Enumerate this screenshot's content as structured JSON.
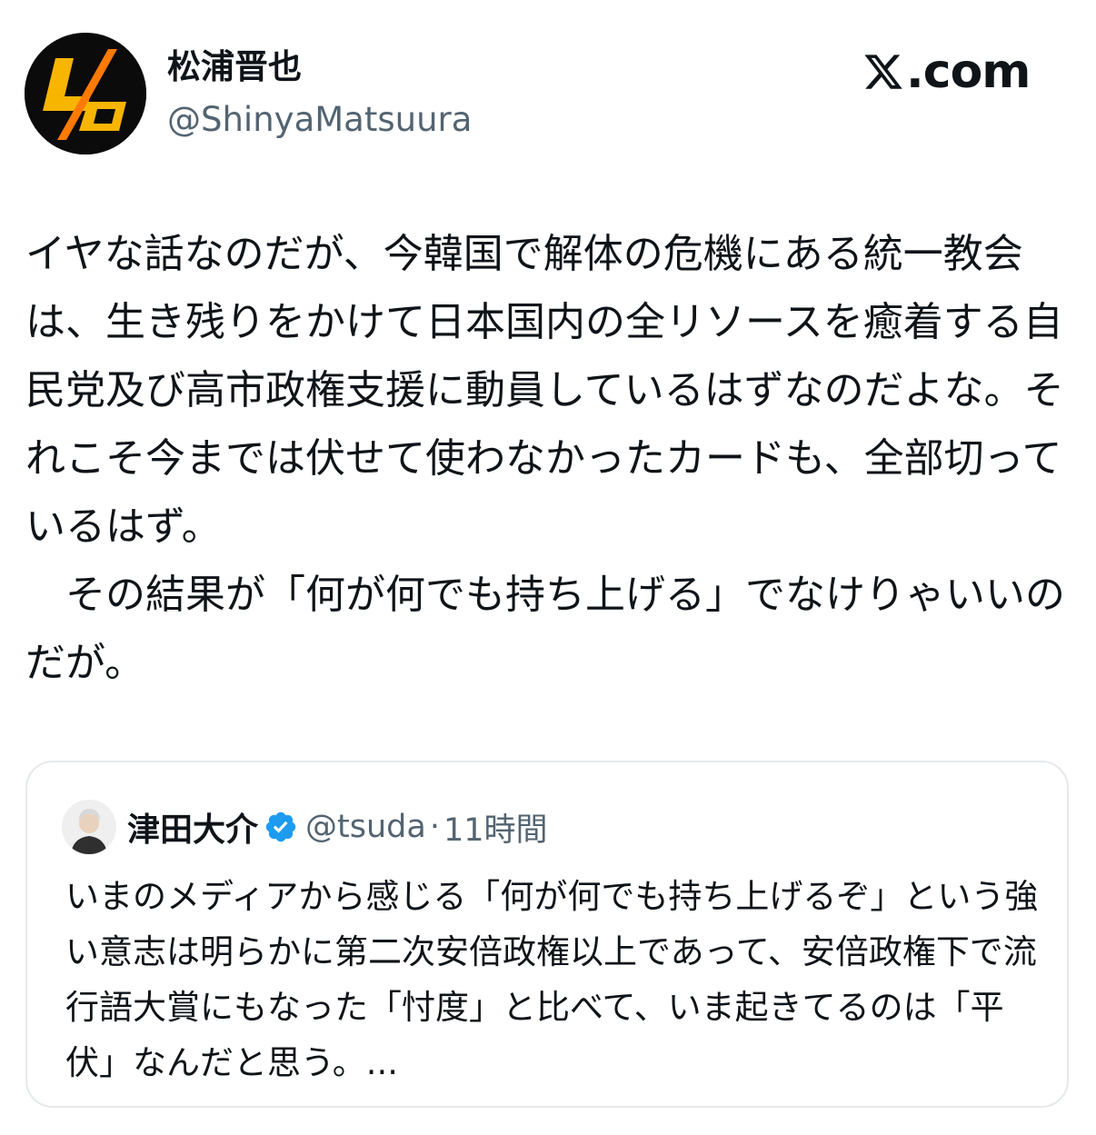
{
  "author": {
    "display_name": "松浦晋也",
    "handle": "@ShinyaMatsuura",
    "avatar_icon": "ld-logo-avatar",
    "avatar_colors": {
      "background": "#0b0b0b",
      "accent": "#f7b500"
    }
  },
  "site": {
    "logo_icon": "x-logo-icon",
    "logo_text": ".com"
  },
  "post": {
    "text": "イヤな話なのだが、今韓国で解体の危機にある統一教会は、生き残りをかけて日本国内の全リソースを癒着する自民党及び高市政権支援に動員しているはずなのだよな。それこそ今までは伏せて使わなかったカードも、全部切っているはず。\n　その結果が「何が何でも持ち上げる」でなけりゃいいのだが。"
  },
  "quoted_post": {
    "display_name": "津田大介",
    "verified_icon": "verified-badge-icon",
    "verified_color": "#1d9bf0",
    "handle": "@tsuda",
    "separator": "·",
    "time": "11時間",
    "text": "いまのメディアから感じる「何が何でも持ち上げるぞ」という強い意志は明らかに第二次安倍政権以上であって、安倍政権下で流行語大賞にもなった「忖度」と比べて、いま起きてるのは「平伏」なんだと思う。..."
  }
}
